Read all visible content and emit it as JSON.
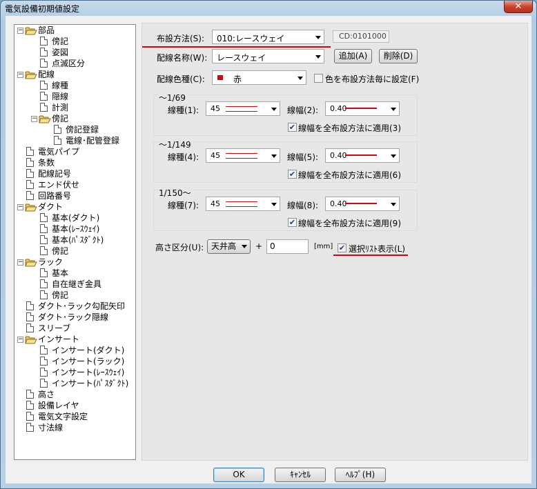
{
  "window": {
    "title": "電気設備初期値設定",
    "close_label": "✕"
  },
  "tree": [
    {
      "label": "部品",
      "type": "folder",
      "expander": "−"
    },
    {
      "label": "傍記",
      "type": "doc"
    },
    {
      "label": "姿図",
      "type": "doc"
    },
    {
      "label": "点滅区分",
      "type": "doc"
    },
    {
      "label": "配線",
      "type": "folder",
      "expander": "−"
    },
    {
      "label": "線種",
      "type": "doc"
    },
    {
      "label": "隠線",
      "type": "doc"
    },
    {
      "label": "計測",
      "type": "doc"
    },
    {
      "label": "傍記",
      "type": "folder",
      "expander": "−"
    },
    {
      "label": "傍記登録",
      "type": "doc"
    },
    {
      "label": "電線･配管登録",
      "type": "doc"
    },
    {
      "label": "電気パイプ",
      "type": "doc"
    },
    {
      "label": "条数",
      "type": "doc"
    },
    {
      "label": "配線記号",
      "type": "doc"
    },
    {
      "label": "エンド伏せ",
      "type": "doc"
    },
    {
      "label": "回路番号",
      "type": "doc"
    },
    {
      "label": "ダクト",
      "type": "folder",
      "expander": "−"
    },
    {
      "label": "基本(ダクト)",
      "type": "doc"
    },
    {
      "label": "基本(ﾚｰｽｳｪｲ)",
      "type": "doc"
    },
    {
      "label": "基本(ﾊﾟｽﾀﾞｸﾄ)",
      "type": "doc"
    },
    {
      "label": "傍記",
      "type": "doc"
    },
    {
      "label": "ラック",
      "type": "folder",
      "expander": "−"
    },
    {
      "label": "基本",
      "type": "doc"
    },
    {
      "label": "自在継ぎ金具",
      "type": "doc"
    },
    {
      "label": "傍記",
      "type": "doc"
    },
    {
      "label": "ダクト･ラック勾配矢印",
      "type": "doc"
    },
    {
      "label": "ダクト･ラック隠線",
      "type": "doc"
    },
    {
      "label": "スリーブ",
      "type": "doc"
    },
    {
      "label": "インサート",
      "type": "folder",
      "expander": "−"
    },
    {
      "label": "インサート(ダクト)",
      "type": "doc"
    },
    {
      "label": "インサート(ラック)",
      "type": "doc"
    },
    {
      "label": "インサート(ﾚｰｽｳｪｲ)",
      "type": "doc"
    },
    {
      "label": "インサート(ﾊﾟｽﾀﾞｸﾄ)",
      "type": "doc"
    },
    {
      "label": "高さ",
      "type": "doc"
    },
    {
      "label": "設備レイヤ",
      "type": "doc"
    },
    {
      "label": "電気文字設定",
      "type": "doc"
    },
    {
      "label": "寸法線",
      "type": "doc"
    }
  ],
  "form": {
    "method_label": "布設方法(S):",
    "method_value": "010:レースウェイ",
    "cd_code": "CD:0101000",
    "name_label": "配線名称(W):",
    "name_value": "レースウェイ",
    "add_button": "追加(A)",
    "delete_button": "削除(D)",
    "color_label": "配線色種(C):",
    "color_value": "赤",
    "color_swatch": "#d9000d",
    "color_per_method_label": "色を布設方法毎に設定(F)",
    "color_per_method_checked": false,
    "groups": [
      {
        "title": "～1/69",
        "type_label": "線種(1):",
        "type_value": "45",
        "width_label": "線幅(2):",
        "width_value": "0.40",
        "apply_label": "線幅を全布設方法に適用(3)",
        "apply_checked": true
      },
      {
        "title": "～1/149",
        "type_label": "線種(4):",
        "type_value": "45",
        "width_label": "線幅(5):",
        "width_value": "0.40",
        "apply_label": "線幅を全布設方法に適用(6)",
        "apply_checked": true
      },
      {
        "title": "1/150～",
        "type_label": "線種(7):",
        "type_value": "45",
        "width_label": "線幅(8):",
        "width_value": "0.40",
        "apply_label": "線幅を全布設方法に適用(9)",
        "apply_checked": true
      }
    ],
    "height_label": "高さ区分(U):",
    "height_value": "天井高",
    "plus": "+",
    "offset_value": "0",
    "unit": "[mm]",
    "select_list_label": "選択ﾘｽﾄ表示(L)",
    "select_list_checked": true
  },
  "buttons": {
    "ok": "OK",
    "cancel": "ｷｬﾝｾﾙ",
    "help": "ﾍﾙﾌﾟ(H)"
  },
  "colors": {
    "accent_red": "#d9000d",
    "panel": "#e7e7e7"
  }
}
